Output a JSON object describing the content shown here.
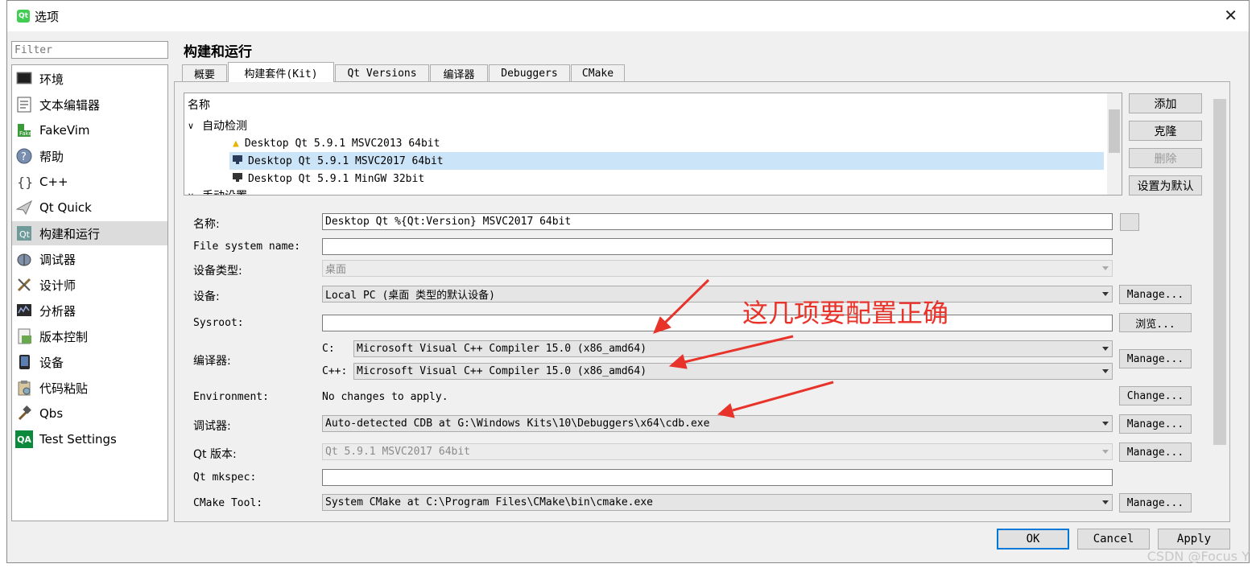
{
  "window": {
    "title": "选项",
    "close_icon": "✕",
    "app_icon_text": "Qt"
  },
  "filter": {
    "placeholder": "Filter"
  },
  "nav": {
    "items": [
      {
        "label": "环境",
        "icon": "monitor-icon"
      },
      {
        "label": "文本编辑器",
        "icon": "text-editor-icon"
      },
      {
        "label": "FakeVim",
        "icon": "fakevim-icon"
      },
      {
        "label": "帮助",
        "icon": "help-icon"
      },
      {
        "label": "C++",
        "icon": "cpp-icon"
      },
      {
        "label": "Qt Quick",
        "icon": "qt-quick-icon"
      },
      {
        "label": "构建和运行",
        "icon": "build-run-icon",
        "selected": true
      },
      {
        "label": "调试器",
        "icon": "debugger-icon"
      },
      {
        "label": "设计师",
        "icon": "designer-icon"
      },
      {
        "label": "分析器",
        "icon": "analyzer-icon"
      },
      {
        "label": "版本控制",
        "icon": "version-control-icon"
      },
      {
        "label": "设备",
        "icon": "device-icon"
      },
      {
        "label": "代码粘贴",
        "icon": "code-paste-icon"
      },
      {
        "label": "Qbs",
        "icon": "qbs-icon"
      },
      {
        "label": "Test Settings",
        "icon": "test-settings-icon",
        "icon_text": "QA"
      }
    ]
  },
  "page_title": "构建和运行",
  "tabs": [
    {
      "label": "概要"
    },
    {
      "label": "构建套件(Kit)",
      "active": true
    },
    {
      "label": "Qt Versions"
    },
    {
      "label": "编译器"
    },
    {
      "label": "Debuggers"
    },
    {
      "label": "CMake"
    }
  ],
  "kit_tree": {
    "header": "名称",
    "group_auto": "自动检测",
    "kits": [
      {
        "label": "Desktop Qt 5.9.1 MSVC2013 64bit",
        "icon": "warning-icon"
      },
      {
        "label": "Desktop Qt 5.9.1 MSVC2017 64bit",
        "icon": "desktop-icon",
        "selected": true
      },
      {
        "label": "Desktop Qt 5.9.1 MinGW 32bit",
        "icon": "desktop-icon"
      }
    ],
    "group_manual": "手动设置"
  },
  "side_buttons": {
    "add": "添加",
    "clone": "克隆",
    "remove": "删除",
    "make_default": "设置为默认"
  },
  "form": {
    "name_label": "名称:",
    "name_value": "Desktop Qt %{Qt:Version} MSVC2017 64bit",
    "fs_label": "File system name:",
    "fs_value": "",
    "device_type_label": "设备类型:",
    "device_type_value": "桌面",
    "device_label": "设备:",
    "device_value": "Local PC (桌面 类型的默认设备)",
    "sysroot_label": "Sysroot:",
    "sysroot_value": "",
    "compiler_label": "编译器:",
    "c_label": "C:",
    "c_value": "Microsoft Visual C++ Compiler 15.0 (x86_amd64)",
    "cpp_label": "C++:",
    "cpp_value": "Microsoft Visual C++ Compiler 15.0 (x86_amd64)",
    "env_label": "Environment:",
    "env_value": "No changes to apply.",
    "debugger_label": "调试器:",
    "debugger_value": "Auto-detected CDB at G:\\Windows Kits\\10\\Debuggers\\x64\\cdb.exe",
    "qt_version_label": "Qt 版本:",
    "qt_version_value": "Qt 5.9.1 MSVC2017 64bit",
    "mkspec_label": "Qt mkspec:",
    "mkspec_value": "",
    "cmake_label": "CMake Tool:",
    "cmake_value": "System CMake at C:\\Program Files\\CMake\\bin\\cmake.exe",
    "manage": "Manage...",
    "browse": "浏览...",
    "change": "Change..."
  },
  "dialog_buttons": {
    "ok": "OK",
    "cancel": "Cancel",
    "apply": "Apply"
  },
  "annotation": {
    "text": "这几项要配置正确",
    "color": "#e8332a"
  },
  "watermark": "CSDN @Focus Y"
}
